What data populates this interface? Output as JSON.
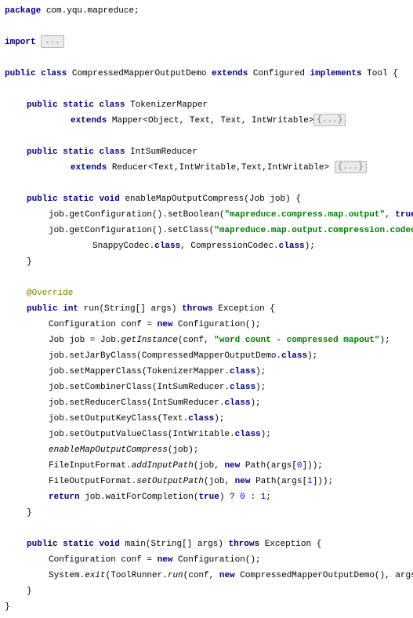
{
  "pkg": {
    "kw": "package",
    "name": "com.yqu.mapreduce;"
  },
  "imp": {
    "kw": "import",
    "fold": "..."
  },
  "cls": {
    "pub": "public",
    "cls": "class",
    "name": "CompressedMapperOutputDemo",
    "ext": "extends",
    "sup": "Configured",
    "impl": "implements",
    "iface": "Tool",
    "open": "{"
  },
  "tok": {
    "pub": "public",
    "stat": "static",
    "cls": "class",
    "name": "TokenizerMapper",
    "ext": "extends",
    "base": "Mapper<Object, Text, Text, IntWritable>",
    "fold": "{...}"
  },
  "red": {
    "pub": "public",
    "stat": "static",
    "cls": "class",
    "name": "IntSumReducer",
    "ext": "extends",
    "base": "Reducer<Text,IntWritable,Text,IntWritable>",
    "fold": "{...}"
  },
  "enable": {
    "pub": "public",
    "stat": "static",
    "void": "void",
    "sig": "enableMapOutputCompress(Job job) {",
    "l1a": "job.getConfiguration().setBoolean(",
    "l1s": "\"mapreduce.compress.map.output\"",
    "l1b": ", ",
    "l1t": "true",
    "l1c": ");",
    "l2a": "job.getConfiguration().setClass(",
    "l2s": "\"mapreduce.map.output.compression.codec\"",
    "l2b": ",",
    "l3a": "SnappyCodec.",
    "l3cls": "class",
    "l3b": ", CompressionCodec.",
    "l3cls2": "class",
    "l3c": ");",
    "close": "}"
  },
  "ov": "@Override",
  "run": {
    "pub": "public",
    "int": "int",
    "sig": "run(String[] args)",
    "throws": "throws",
    "exc": "Exception {",
    "c1a": "Configuration conf = ",
    "c1new": "new",
    "c1b": " Configuration();",
    "c2a": "Job job = Job.",
    "c2it": "getInstance",
    "c2b": "(conf, ",
    "c2s": "\"word count - compressed mapout\"",
    "c2c": ");",
    "c3a": "job.setJarByClass(CompressedMapperOutputDemo.",
    "cls": "class",
    "c3b": ");",
    "c4a": "job.setMapperClass(TokenizerMapper.",
    "c4b": ");",
    "c5a": "job.setCombinerClass(IntSumReducer.",
    "c5b": ");",
    "c6a": "job.setReducerClass(IntSumReducer.",
    "c6b": ");",
    "c7a": "job.setOutputKeyClass(Text.",
    "c7b": ");",
    "c8a": "job.setOutputValueClass(IntWritable.",
    "c8b": ");",
    "c9it": "enableMapOutputCompress",
    "c9b": "(job);",
    "c10a": "FileInputFormat.",
    "c10it": "addInputPath",
    "c10b": "(job, ",
    "c10new": "new",
    "c10c": " Path(args[",
    "c10n": "0",
    "c10d": "]));",
    "c11a": "FileOutputFormat.",
    "c11it": "setOutputPath",
    "c11b": "(job, ",
    "c11new": "new",
    "c11c": " Path(args[",
    "c11n": "1",
    "c11d": "]));",
    "ret": "return",
    "retb": " job.waitForCompletion(",
    "rett": "true",
    "retc": ") ? ",
    "r0": "0",
    "retd": " : ",
    "r1": "1",
    "rete": ";",
    "close": "}"
  },
  "main": {
    "pub": "public",
    "stat": "static",
    "void": "void",
    "sig": "main(String[] args)",
    "throws": "throws",
    "exc": "Exception {",
    "c1a": "Configuration conf = ",
    "c1new": "new",
    "c1b": " Configuration();",
    "c2a": "System.",
    "c2it": "exit",
    "c2b": "(ToolRunner.",
    "c2it2": "run",
    "c2c": "(conf, ",
    "c2new": "new",
    "c2d": " CompressedMapperOutputDemo(), args));",
    "close": "}"
  },
  "clsClose": "}"
}
